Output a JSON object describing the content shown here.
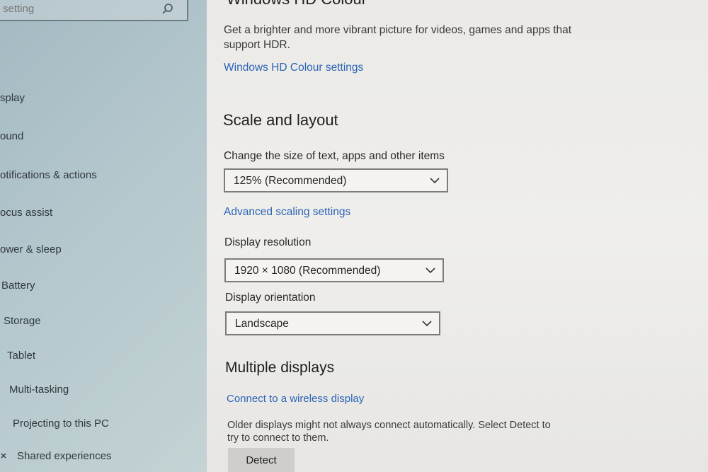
{
  "search": {
    "placeholder": "setting"
  },
  "sidebar": {
    "items": [
      {
        "label": "splay"
      },
      {
        "label": "ound"
      },
      {
        "label": "otifications & actions"
      },
      {
        "label": "ocus assist"
      },
      {
        "label": "ower & sleep"
      },
      {
        "label": "Battery"
      },
      {
        "label": "Storage"
      },
      {
        "label": "Tablet"
      },
      {
        "label": "Multi-tasking"
      },
      {
        "label": "Projecting to this PC"
      },
      {
        "label": "Shared experiences"
      }
    ]
  },
  "main": {
    "top_heading": "Windows HD Colour",
    "hdr_description_line1": "Get a brighter and more vibrant picture for videos, games and apps that",
    "hdr_description_line2": "support HDR.",
    "hdr_link": "Windows HD Colour settings",
    "scale_heading": "Scale and layout",
    "scale_label": "Change the size of text, apps and other items",
    "scale_value": "125% (Recommended)",
    "advanced_scaling_link": "Advanced scaling settings",
    "resolution_label": "Display resolution",
    "resolution_value": "1920 × 1080 (Recommended)",
    "orientation_label": "Display orientation",
    "orientation_value": "Landscape",
    "multiple_heading": "Multiple displays",
    "wireless_link": "Connect to a wireless display",
    "detect_description_line1": "Older displays might not always connect automatically. Select Detect to",
    "detect_description_line2": "try to connect to them.",
    "detect_button": "Detect"
  }
}
